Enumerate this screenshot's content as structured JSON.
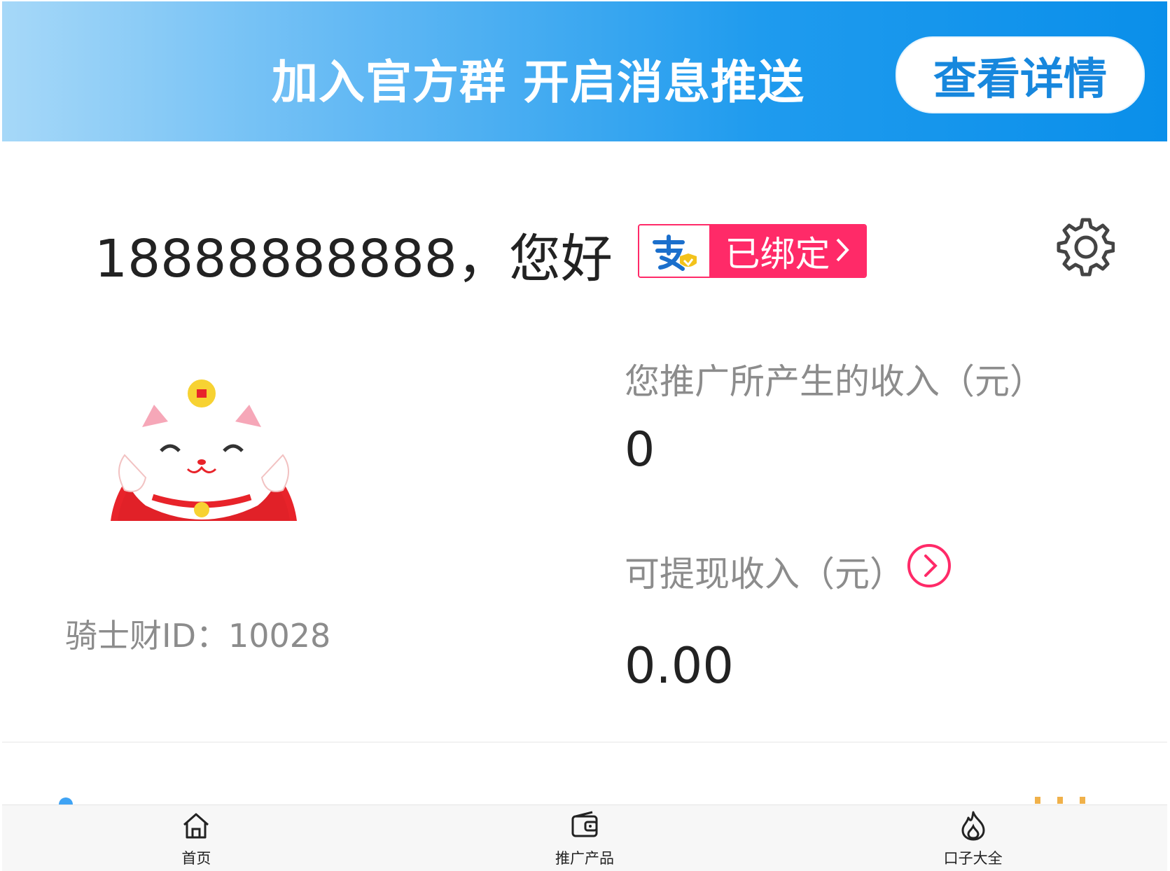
{
  "banner": {
    "slogan": "加入官方群 开启消息推送",
    "button_label": "查看详情"
  },
  "user": {
    "greeting": "18888888888，您好",
    "bind_status": "已绑定",
    "bind_logo": "alipay-logo",
    "rider_id": "骑士财ID：10028"
  },
  "earnings": {
    "income_label": "您推广所产生的收入（元）",
    "income_value": "0",
    "withdraw_label": "可提现收入（元）",
    "withdraw_value": "0.00"
  },
  "tabbar": {
    "items": [
      {
        "label": "首页",
        "icon": "home-icon"
      },
      {
        "label": "推广产品",
        "icon": "wallet-icon"
      },
      {
        "label": "口子大全",
        "icon": "flame-icon"
      }
    ]
  },
  "colors": {
    "accent_pink": "#ff2a68",
    "banner_blue": "#0a8fea",
    "text_gray": "#8c8c8c"
  }
}
